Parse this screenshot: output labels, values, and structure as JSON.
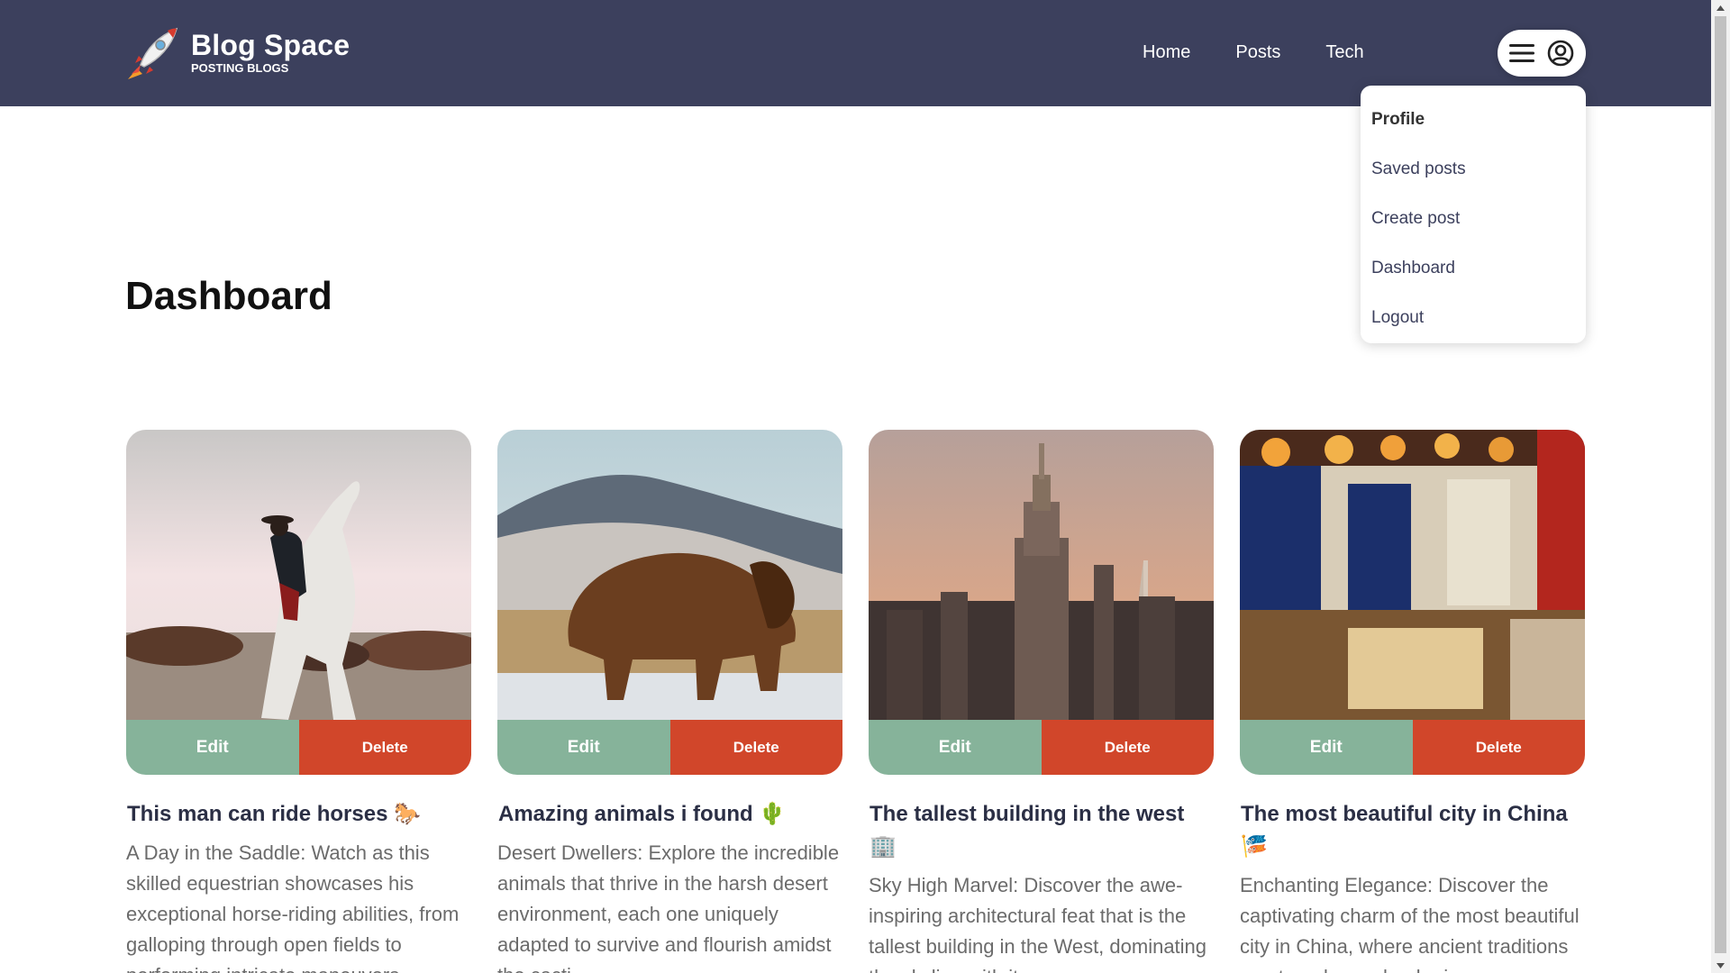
{
  "header": {
    "brand_title": "Blog Space",
    "brand_subtitle": "POSTING BLOGS",
    "background_color": "#3c405d",
    "logo_icon": "rocket-icon",
    "nav": [
      {
        "label": "Home"
      },
      {
        "label": "Posts"
      },
      {
        "label": "Tech"
      }
    ],
    "user_menu": {
      "icons": [
        "hamburger-icon",
        "account-circle-icon"
      ]
    }
  },
  "dropdown": {
    "items": [
      {
        "label": "Profile"
      },
      {
        "label": "Saved posts"
      },
      {
        "label": "Create post"
      },
      {
        "label": "Dashboard"
      },
      {
        "label": "Logout"
      }
    ]
  },
  "main": {
    "title": "Dashboard",
    "cards": [
      {
        "title": "This man can ride horses 🐎",
        "description": "A Day in the Saddle: Watch as this skilled equestrian showcases his exceptional horse-riding abilities, from galloping through open fields to performing intricate maneuvers",
        "edit_label": "Edit",
        "delete_label": "Delete"
      },
      {
        "title": "Amazing animals i found 🌵",
        "description": "Desert Dwellers: Explore the incredible animals that thrive in the harsh desert environment, each one uniquely adapted to survive and flourish amidst the cacti",
        "edit_label": "Edit",
        "delete_label": "Delete"
      },
      {
        "title": "The tallest building in the west 🏢",
        "description": "Sky High Marvel: Discover the awe-inspiring architectural feat that is the tallest building in the West, dominating the skyline with its",
        "edit_label": "Edit",
        "delete_label": "Delete"
      },
      {
        "title": "The most beautiful city in China 🎏",
        "description": "Enchanting Elegance: Discover the captivating charm of the most beautiful city in China, where ancient traditions meet modern splendor in a",
        "edit_label": "Edit",
        "delete_label": "Delete"
      }
    ]
  },
  "colors": {
    "edit_button": "#86b39a",
    "delete_button": "#d1462a",
    "title_text": "#2b2f45",
    "description_text": "#6b6b6b"
  }
}
